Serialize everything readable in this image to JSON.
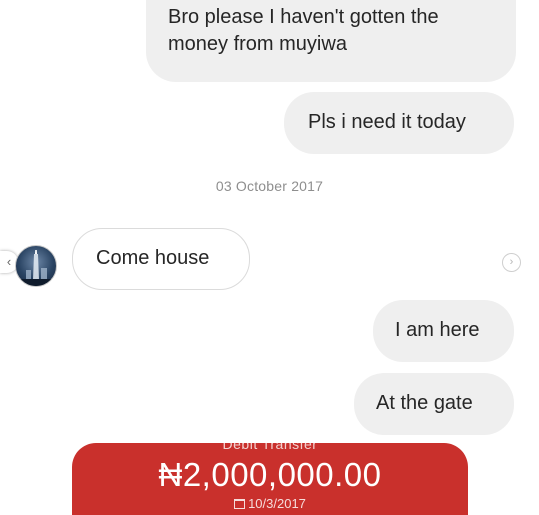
{
  "messages": {
    "sent_1": "Bro please I haven't gotten the money from muyiwa",
    "sent_2": "Pls i need it today",
    "received_1": "Come house",
    "sent_3": "I am here",
    "sent_4": "At the gate"
  },
  "date_separator": "03 October 2017",
  "icons": {
    "left": "chevron-left-icon",
    "right": "chevron-right-icon",
    "calendar": "calendar-icon",
    "avatar": "avatar"
  },
  "transfer_card": {
    "label": "Debit Transfer",
    "amount": "₦2,000,000.00",
    "date": "10/3/2017",
    "color": "#c9302c"
  }
}
